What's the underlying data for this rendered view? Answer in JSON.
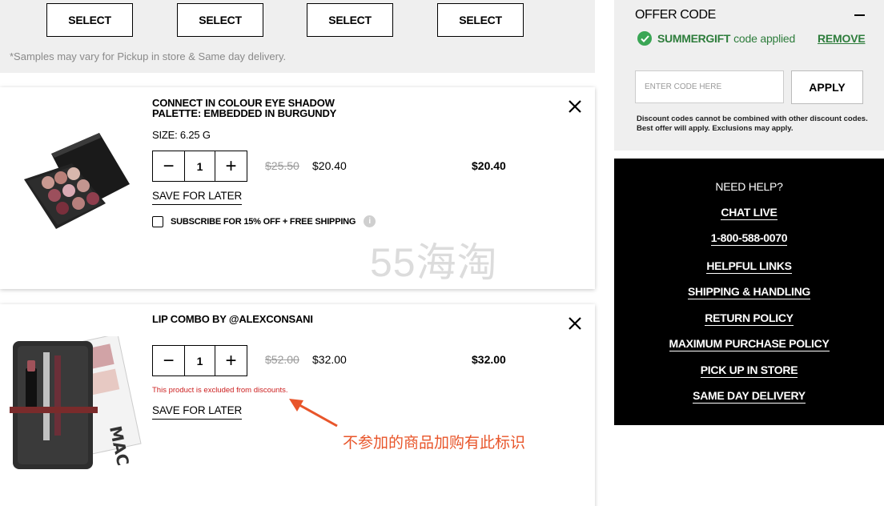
{
  "samples": {
    "select_labels": [
      "SELECT",
      "SELECT",
      "SELECT",
      "SELECT"
    ],
    "note": "*Samples may vary for Pickup in store & Same day delivery."
  },
  "cart": {
    "items": [
      {
        "name_line1": "CONNECT IN COLOUR EYE SHADOW",
        "name_line2": "PALETTE: EMBEDDED IN BURGUNDY",
        "size": "SIZE: 6.25 G",
        "quantity": "1",
        "qty_minus": "−",
        "qty_plus": "+",
        "original_price": "$25.50",
        "sale_price": "$20.40",
        "total": "$20.40",
        "save_for_later": "SAVE FOR LATER",
        "subscribe_label": "SUBSCRIBE FOR 15% OFF + FREE SHIPPING",
        "info_glyph": "i",
        "remove_icon": "close-icon"
      },
      {
        "name_line1": "LIP COMBO BY @ALEXCONSANI",
        "quantity": "1",
        "qty_minus": "−",
        "qty_plus": "+",
        "original_price": "$52.00",
        "sale_price": "$32.00",
        "total": "$32.00",
        "excluded_message": "This product is excluded from discounts.",
        "save_for_later": "SAVE FOR LATER",
        "remove_icon": "close-icon"
      }
    ]
  },
  "offer": {
    "title": "OFFER CODE",
    "applied_code": "SUMMERGIFT",
    "applied_suffix": "code applied",
    "remove_label": "REMOVE",
    "input_placeholder": "ENTER CODE HERE",
    "apply_label": "APPLY",
    "note": "Discount codes cannot be combined with other discount codes. Best offer will apply. Exclusions may apply.",
    "accent_color": "#2e7d3c"
  },
  "help": {
    "title": "NEED HELP?",
    "links": [
      "CHAT LIVE",
      "1-800-588-0070",
      "HELPFUL LINKS",
      "SHIPPING & HANDLING",
      "RETURN POLICY",
      "MAXIMUM PURCHASE POLICY",
      "PICK UP IN STORE",
      "SAME DAY DELIVERY"
    ]
  },
  "watermark": "55海淘",
  "annotation": "不参加的商品加购有此标识",
  "colors": {
    "annotation": "#e8552a",
    "error": "#cc1f1f",
    "panel_bg": "#efefef",
    "help_bg": "#000000"
  }
}
